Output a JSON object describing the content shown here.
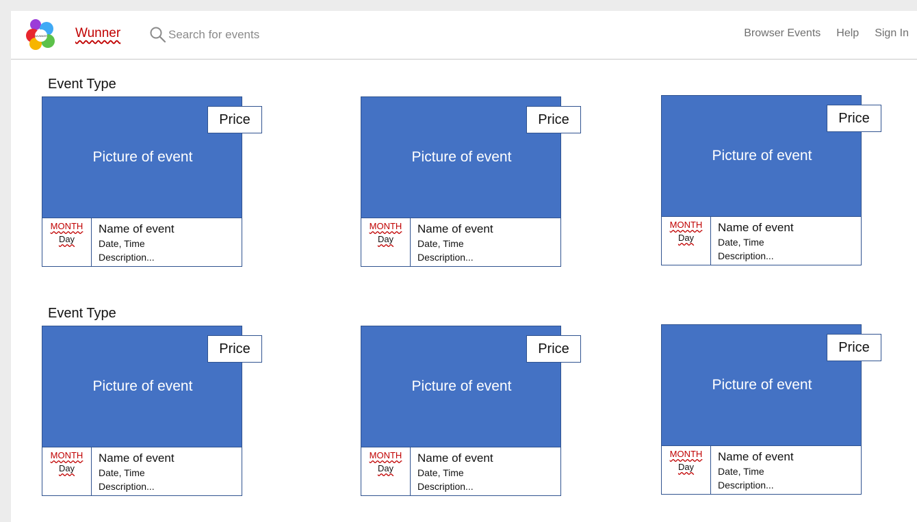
{
  "header": {
    "brand": "Wunner",
    "logo_text": "WUNNER",
    "search_placeholder": "Search for events",
    "nav": [
      "Browser Events",
      "Help",
      "Sign In"
    ]
  },
  "sections": [
    {
      "title": "Event Type",
      "cards": [
        {
          "price": "Price",
          "picture": "Picture of event",
          "month": "MONTH",
          "day": "Day",
          "name": "Name of event",
          "datetime": "Date, Time",
          "description": "Description..."
        },
        {
          "price": "Price",
          "picture": "Picture of event",
          "month": "MONTH",
          "day": "Day",
          "name": "Name of event",
          "datetime": "Date, Time",
          "description": "Description..."
        },
        {
          "price": "Price",
          "picture": "Picture of event",
          "month": "MONTH",
          "day": "Day",
          "name": "Name of event",
          "datetime": "Date, Time",
          "description": "Description..."
        }
      ]
    },
    {
      "title": "Event Type",
      "cards": [
        {
          "price": "Price",
          "picture": "Picture of event",
          "month": "MONTH",
          "day": "Day",
          "name": "Name of event",
          "datetime": "Date, Time",
          "description": "Description..."
        },
        {
          "price": "Price",
          "picture": "Picture of event",
          "month": "MONTH",
          "day": "Day",
          "name": "Name of event",
          "datetime": "Date, Time",
          "description": "Description..."
        },
        {
          "price": "Price",
          "picture": "Picture of event",
          "month": "MONTH",
          "day": "Day",
          "name": "Name of event",
          "datetime": "Date, Time",
          "description": "Description..."
        }
      ]
    }
  ],
  "colors": {
    "picture_fill": "#4472c4",
    "border": "#2f528f",
    "accent_red": "#c00000"
  }
}
